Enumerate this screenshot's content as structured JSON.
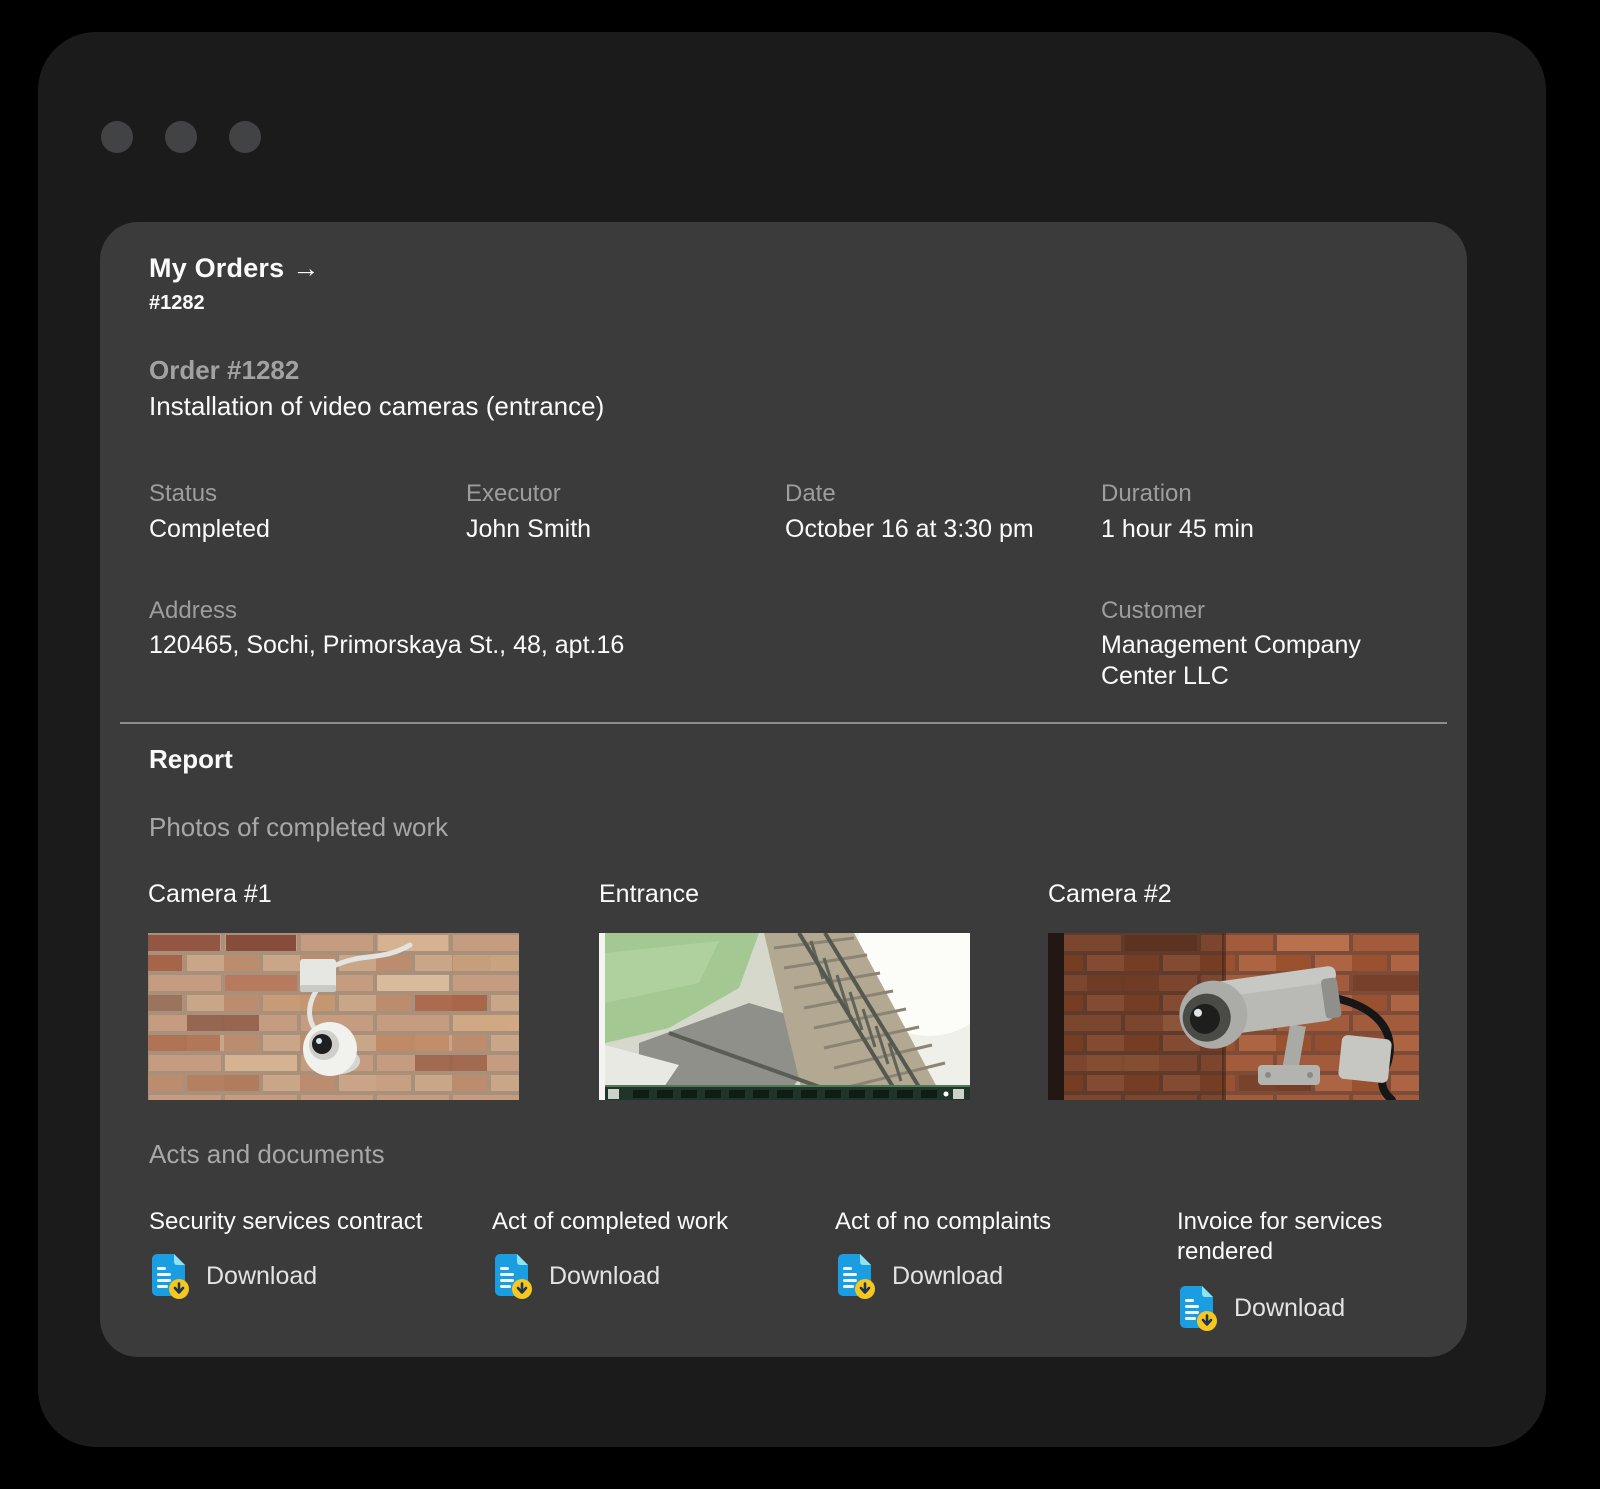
{
  "breadcrumb": {
    "title": "My Orders",
    "arrow_icon": "→",
    "order_ref": "#1282"
  },
  "order": {
    "heading": "Order #1282",
    "subtitle": "Installation of video cameras (entrance)",
    "meta": [
      {
        "label": "Status",
        "value": "Completed"
      },
      {
        "label": "Executor",
        "value": "John Smith"
      },
      {
        "label": "Date",
        "value": "October 16 at 3:30 pm"
      },
      {
        "label": "Duration",
        "value": "1 hour 45 min"
      }
    ],
    "address": {
      "label": "Address",
      "value": "120465, Sochi, Primorskaya St., 48, apt.16"
    },
    "customer": {
      "label": "Customer",
      "value": "Management Company Center LLC"
    }
  },
  "report": {
    "title": "Report",
    "photos_heading": "Photos of completed work",
    "photos": [
      {
        "label": "Camera #1",
        "description": "white dome camera on brick wall"
      },
      {
        "label": "Entrance",
        "description": "fisheye CCTV view of stairwell with timeline bar"
      },
      {
        "label": "Camera #2",
        "description": "bullet camera on red brick wall"
      }
    ],
    "documents_heading": "Acts and documents",
    "documents": [
      {
        "title": "Security services contract",
        "action": "Download"
      },
      {
        "title": "Act of completed work",
        "action": "Download"
      },
      {
        "title": "Act of no complaints",
        "action": "Download"
      },
      {
        "title": "Invoice for services rendered",
        "action": "Download"
      }
    ]
  },
  "colors": {
    "page_bg": "#000000",
    "window_bg": "#1b1b1c",
    "card_bg": "#3b3b3b",
    "label_gray": "#9d9d9d",
    "text_white": "#fafafa",
    "doc_icon_blue": "#1b9de2",
    "doc_icon_fold_cyan": "#8fe3f2",
    "download_badge_yellow": "#f6c71e"
  }
}
